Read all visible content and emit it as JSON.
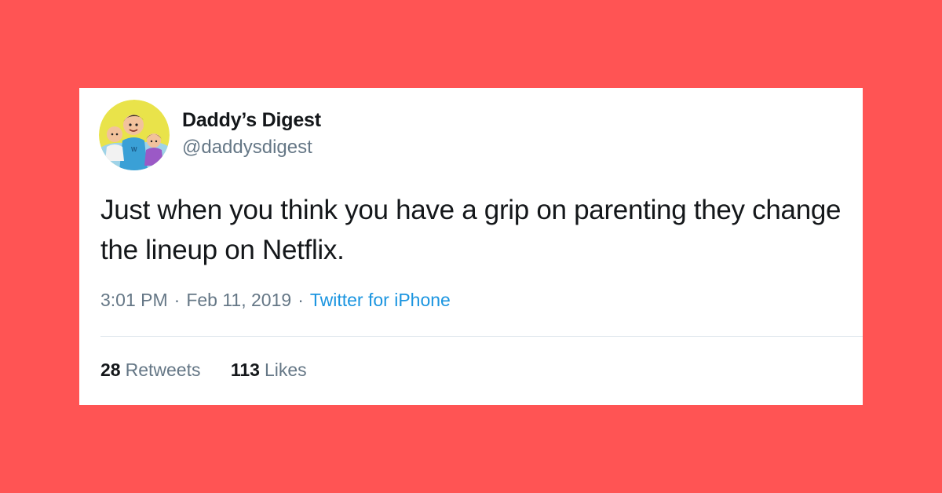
{
  "background_color": "#ff5454",
  "tweet": {
    "avatar_icon": "cartoon-family-avatar",
    "display_name": "Daddy’s Digest",
    "handle": "@daddysdigest",
    "text": "Just when you think you have a grip on parenting they change the lineup on Netflix.",
    "time": "3:01 PM",
    "separator": "·",
    "date": "Feb 11, 2019",
    "source": "Twitter for iPhone",
    "source_color": "#1b95e0",
    "retweets": {
      "count": "28",
      "label": "Retweets"
    },
    "likes": {
      "count": "113",
      "label": "Likes"
    }
  }
}
